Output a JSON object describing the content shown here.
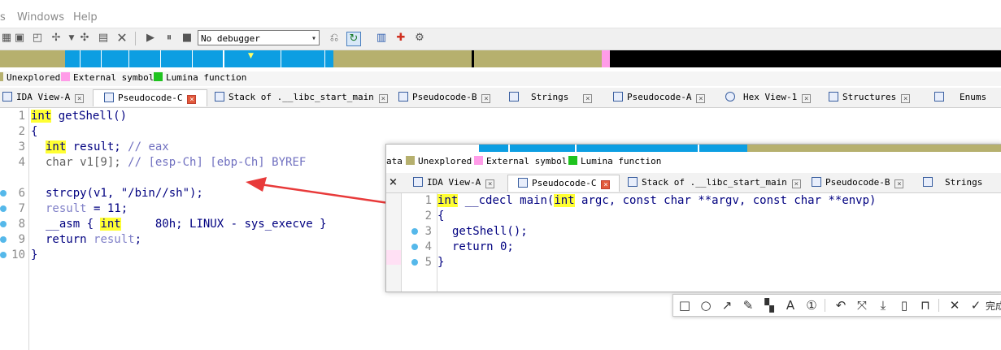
{
  "menu": {
    "item1": "s",
    "windows": "Windows",
    "help": "Help"
  },
  "toolbar": {
    "debugger_select": "No debugger",
    "icons": [
      "new-segment-icon",
      "segment-plus-icon",
      "segment-star-icon",
      "ida-segment-icon",
      "struct-icon",
      "edit-segment-icon",
      "close-segment-icon",
      "play-icon",
      "pause-icon",
      "stop-icon",
      "debug-attach-icon",
      "debug-run-icon",
      "graph-icon",
      "plugin-icon",
      "breakpoint-icon"
    ]
  },
  "legend": {
    "unexplored": "Unexplored",
    "external": "External symbol",
    "lumina": "Lumina function"
  },
  "colors": {
    "code_blue": "#0c9ee2",
    "unexplored": "#b6b06e",
    "external": "#ff9ce8",
    "lumina": "#1fc31f",
    "highlight": "#ffff33"
  },
  "main_tabs": [
    {
      "label": "IDA View-A"
    },
    {
      "label": "Pseudocode-C"
    },
    {
      "label": "Stack of .__libc_start_main"
    },
    {
      "label": "Pseudocode-B"
    },
    {
      "label": "Strings"
    },
    {
      "label": "Pseudocode-A"
    },
    {
      "label": "Hex View-1"
    },
    {
      "label": "Structures"
    },
    {
      "label": "Enums"
    }
  ],
  "code": {
    "line_numbers": [
      "1",
      "2",
      "3",
      "4",
      "6",
      "7",
      "8",
      "9",
      "10"
    ],
    "l1_kw": "int",
    "l1_rest": " getShell()",
    "l2": "{",
    "l3_kw": "int",
    "l3_a": " result; ",
    "l3_cm": "// eax",
    "l4_a": "char v1[9]; ",
    "l4_cm": "// [esp-Ch] [ebp-Ch] BYREF",
    "l6": "strcpy(v1, \"/bin//sh\");",
    "l7_var": "result",
    "l7_rest": " = 11;",
    "l8_a": "__asm { ",
    "l8_kw": "int",
    "l8_b": "     80h; LINUX - sys_execve }",
    "l9_a": "return ",
    "l9_var": "result",
    "l9_b": ";",
    "l10": "}"
  },
  "popup": {
    "legend_prefix": "ata",
    "legend": {
      "unexplored": "Unexplored",
      "external": "External symbol",
      "lumina": "Lumina function"
    },
    "tabs": [
      {
        "label": "IDA View-A"
      },
      {
        "label": "Pseudocode-C"
      },
      {
        "label": "Stack of .__libc_start_main"
      },
      {
        "label": "Pseudocode-B"
      },
      {
        "label": "Strings"
      }
    ],
    "close": "×",
    "line_numbers": [
      "1",
      "2",
      "3",
      "4",
      "5"
    ],
    "l1_kw1": "int",
    "l1_a": " __cdecl main(",
    "l1_kw2": "int",
    "l1_b": " argc, const char **argv, const char **envp)",
    "l2": "{",
    "l3": "getShell();",
    "l4": "return 0;",
    "l5": "}"
  },
  "screenshot_toolbar": {
    "icons": [
      "rectangle-icon",
      "circle-icon",
      "arrow-icon",
      "pen-icon",
      "mosaic-icon",
      "text-icon",
      "number-icon",
      "undo-icon",
      "pin-icon",
      "download-icon",
      "copy-icon",
      "bookmark-icon",
      "cancel-icon",
      "confirm-icon"
    ],
    "done_label": "完成"
  }
}
